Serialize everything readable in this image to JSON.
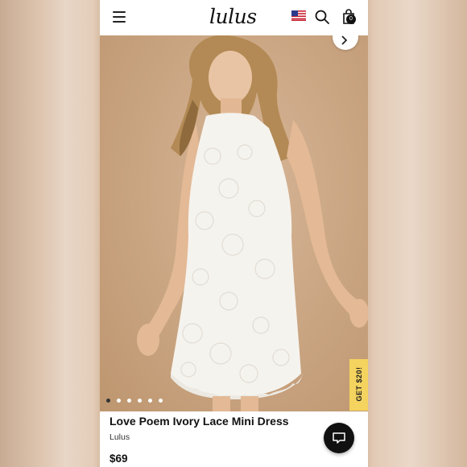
{
  "header": {
    "logo_text": "lulus",
    "cart_count": "0",
    "flag_icon": "us-flag-icon",
    "search_icon": "search-icon",
    "bag_icon": "shopping-bag-icon"
  },
  "gallery": {
    "image_count": 6,
    "active_index": 0,
    "promo_label": "GET $20!"
  },
  "product": {
    "title": "Love Poem Ivory Lace Mini Dress",
    "brand": "Lulus",
    "price": "$69"
  },
  "colors": {
    "promo_tab": "#f4d35e",
    "chat_button": "#111111"
  }
}
